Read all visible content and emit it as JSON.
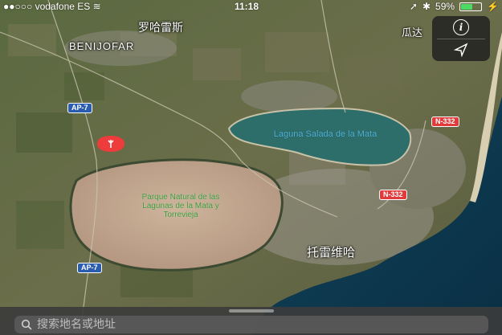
{
  "status_bar": {
    "carrier": "●●○○○ vodafone ES",
    "time": "11:18",
    "battery": "59%",
    "battery_level": 0.59
  },
  "map": {
    "place_labels": [
      "罗哈雷斯",
      "BENIJOFAR",
      "托雷维哈",
      "瓜达"
    ],
    "water_labels": [
      "Laguna Salada de la Mata"
    ],
    "park_labels": [
      "Parque Natural de las Lagunas de la Mata y Torrevieja"
    ],
    "road_shields": {
      "ap7_a": "AP-7",
      "ap7_b": "AP-7",
      "n332_a": "N-332",
      "n332_b": "N-332"
    },
    "colors": {
      "water": "#1e5c66",
      "lagoon_salt": "#c2a98f",
      "land": "#5b6a3c",
      "sea": "#0e3b52"
    }
  },
  "controls": {
    "info_icon": "info-icon",
    "location_icon": "location-arrow-icon"
  },
  "search": {
    "placeholder": "搜索地名或地址"
  }
}
